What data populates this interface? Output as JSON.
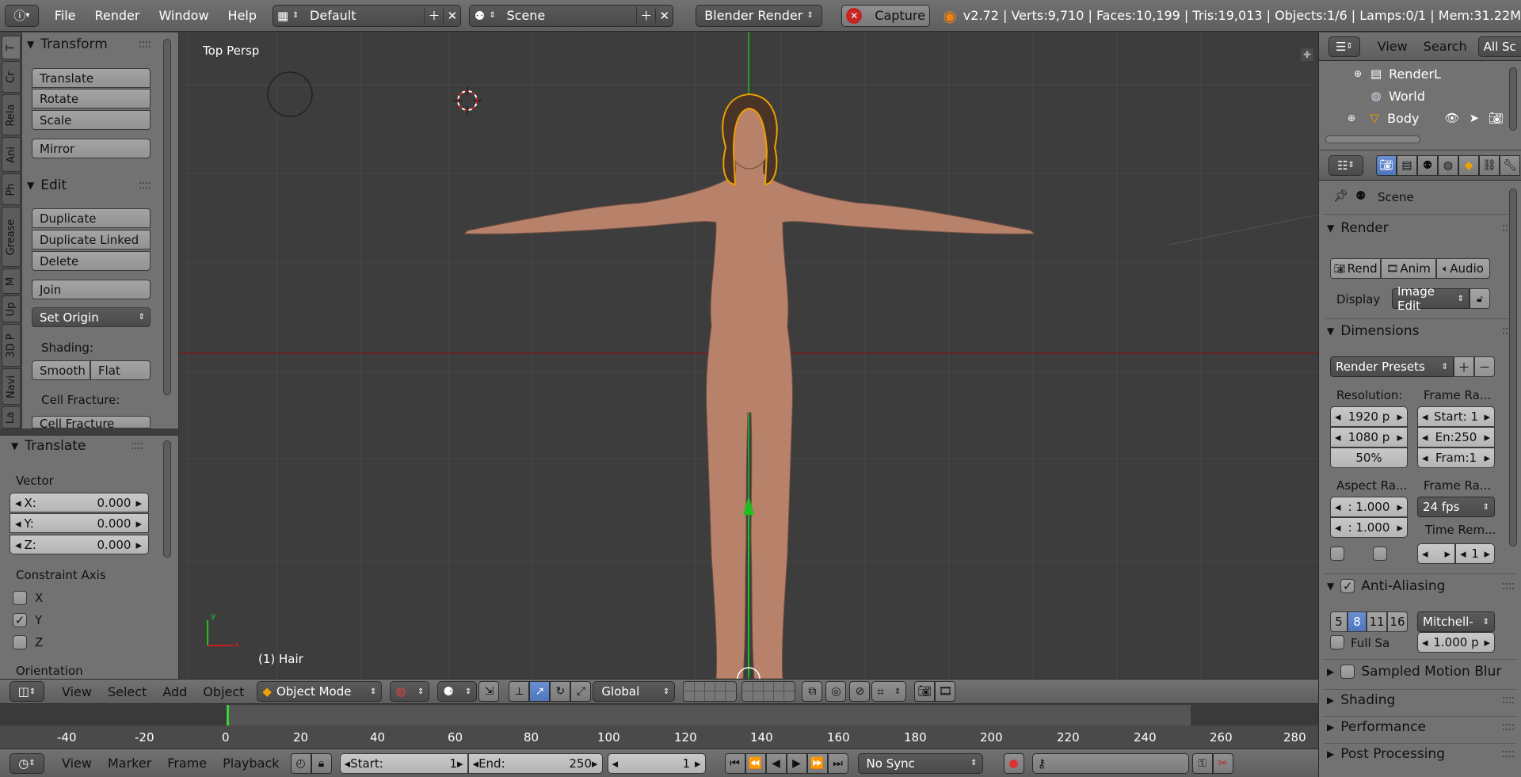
{
  "topbar": {
    "menus": [
      "File",
      "Render",
      "Window",
      "Help"
    ],
    "screen_layout": "Default",
    "scene": "Scene",
    "render_engine": "Blender Render",
    "capture_label": "Capture",
    "stats": "v2.72 | Verts:9,710 | Faces:10,199 | Tris:19,013 | Objects:1/6 | Lamps:0/1 | Mem:31.22M"
  },
  "left_tabs": [
    "T",
    "Cr",
    "Rela",
    "Ani",
    "Ph",
    "Grease",
    "M",
    "Up",
    "3D P",
    "Navi",
    "La"
  ],
  "toolshelf": {
    "transform_title": "Transform",
    "translate": "Translate",
    "rotate": "Rotate",
    "scale": "Scale",
    "mirror": "Mirror",
    "edit_title": "Edit",
    "duplicate": "Duplicate",
    "duplicate_linked": "Duplicate Linked",
    "delete": "Delete",
    "join": "Join",
    "set_origin": "Set Origin",
    "shading_label": "Shading:",
    "smooth": "Smooth",
    "flat": "Flat",
    "cell_fracture_label": "Cell Fracture:",
    "cell_fracture": "Cell Fracture"
  },
  "redo": {
    "title": "Translate",
    "vector_label": "Vector",
    "x_label": "X:",
    "x_value": "0.000",
    "y_label": "Y:",
    "y_value": "0.000",
    "z_label": "Z:",
    "z_value": "0.000",
    "constraint_label": "Constraint Axis",
    "axis_x": "X",
    "axis_y": "Y",
    "axis_z": "Z",
    "axis_x_checked": false,
    "axis_y_checked": true,
    "axis_z_checked": false,
    "orientation_label": "Orientation"
  },
  "viewport": {
    "view_name": "Top Persp",
    "object_label": "(1) Hair",
    "axis_y": "y",
    "axis_x": "x"
  },
  "vp_header": {
    "menus": [
      "View",
      "Select",
      "Add",
      "Object"
    ],
    "mode": "Object Mode",
    "orientation": "Global"
  },
  "timeline": {
    "ticks": [
      "-40",
      "-20",
      "0",
      "20",
      "40",
      "60",
      "80",
      "100",
      "120",
      "140",
      "160",
      "180",
      "200",
      "220",
      "240",
      "260",
      "280"
    ],
    "menus": [
      "View",
      "Marker",
      "Frame",
      "Playback"
    ],
    "start_label": "Start:",
    "start_value": "1",
    "end_label": "End:",
    "end_value": "250",
    "current_frame": "1",
    "sync": "No Sync"
  },
  "outliner": {
    "menus": [
      "View",
      "Search"
    ],
    "filter": "All Sc",
    "rows": [
      "RenderL",
      "World",
      "Body"
    ]
  },
  "properties": {
    "context_scene": "Scene",
    "render_title": "Render",
    "render_btn": "Rend",
    "anim_btn": "Anim",
    "audio_btn": "Audio",
    "display_label": "Display",
    "display_value": "Image Edit",
    "dimensions_title": "Dimensions",
    "render_presets": "Render Presets",
    "resolution_label": "Resolution:",
    "frame_range_label": "Frame Ra...",
    "res_x": "1920 p",
    "res_y": "1080 p",
    "res_pct": "50%",
    "start": "Start: 1",
    "end": "En:250",
    "frame_step": "Fram:1",
    "aspect_label": "Aspect Ra...",
    "frame_rate_label": "Frame Ra...",
    "aspect_x": ": 1.000",
    "aspect_y": ": 1.000",
    "fps": "24 fps",
    "time_remap_label": "Time Rem...",
    "time_remap_value": "1",
    "aa_title": "Anti-Aliasing",
    "aa_samples": [
      "5",
      "8",
      "11",
      "16"
    ],
    "aa_selected": "8",
    "aa_filter": "Mitchell-",
    "full_sample": "Full Sa",
    "filter_size": "1.000 p",
    "smb_title": "Sampled Motion Blur",
    "shading_title": "Shading",
    "performance_title": "Performance",
    "post_processing_title": "Post Processing"
  },
  "colors": {
    "accent_blue": "#5680c2",
    "x_axis": "#a11d1d",
    "y_axis": "#1fbf1f",
    "selection_outline": "#f0a000",
    "skin": "#b9836b"
  }
}
